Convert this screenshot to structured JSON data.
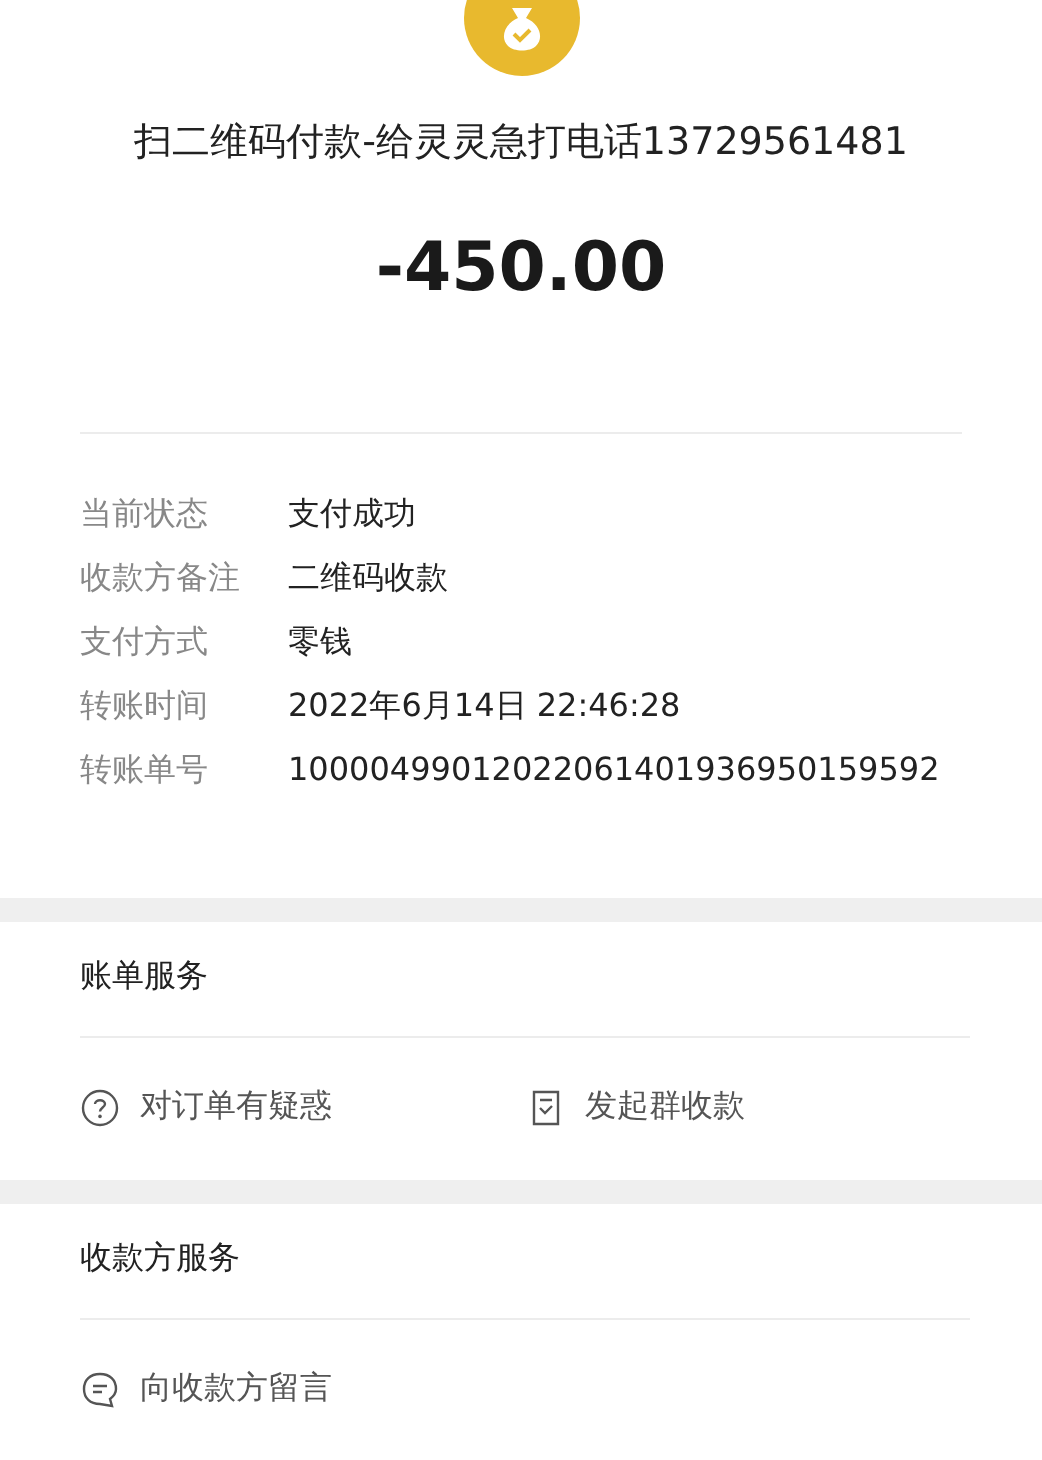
{
  "title": "扫二维码付款-给灵灵急打电话13729561481",
  "amount": "-450.00",
  "details": [
    {
      "label": "当前状态",
      "value": "支付成功"
    },
    {
      "label": "收款方备注",
      "value": "二维码收款"
    },
    {
      "label": "支付方式",
      "value": "零钱"
    },
    {
      "label": "转账时间",
      "value": "2022年6月14日 22:46:28"
    },
    {
      "label": "转账单号",
      "value": "10000499012022061401936950159592"
    }
  ],
  "sections": [
    {
      "heading": "账单服务",
      "actions": [
        {
          "kind": "question",
          "label": "对订单有疑惑"
        },
        {
          "kind": "bill",
          "label": "发起群收款"
        }
      ]
    },
    {
      "heading": "收款方服务",
      "actions": [
        {
          "kind": "message",
          "label": "向收款方留言"
        }
      ]
    }
  ]
}
